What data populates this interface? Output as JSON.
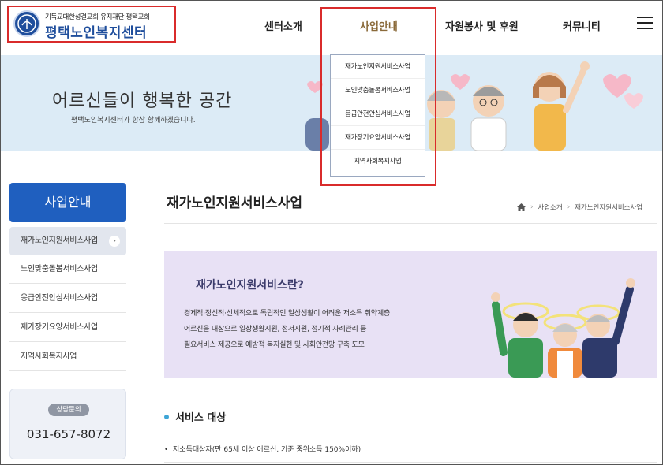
{
  "header": {
    "org_line": "기독교대한성결교회 유지재단 평택교회",
    "center_name": "평택노인복지센터",
    "nav": [
      "센터소개",
      "사업안내",
      "자원봉사 및 후원",
      "커뮤니티"
    ],
    "menu_icon": "hamburger-menu-icon"
  },
  "dropdown": {
    "items": [
      "재가노인지원서비스사업",
      "노인맞춤돌봄서비스사업",
      "응급안전안심서비스사업",
      "재가장기요양서비스사업",
      "지역사회복지사업"
    ]
  },
  "banner": {
    "title": "어르신들이 행복한 공간",
    "subtitle": "평택노인복지센터가 항상 함께하겠습니다."
  },
  "sidebar": {
    "heading": "사업안내",
    "items": [
      "재가노인지원서비스사업",
      "노인맞춤돌봄서비스사업",
      "응급안전안심서비스사업",
      "재가장기요양서비스사업",
      "지역사회복지사업"
    ],
    "active_arrow": "›",
    "contact_badge": "상담문의",
    "contact_phone": "031-657-8072"
  },
  "main": {
    "title": "재가노인지원서비스사업",
    "breadcrumb": [
      "사업소개",
      "재가노인지원서비스사업"
    ],
    "home_icon": "home-icon",
    "intro_title": "재가노인지원서비스란?",
    "intro_lines": [
      "경제적·정신적·신체적으로 독립적인 일상생활이 어려운 저소득 취약계층",
      "어르신을 대상으로 일상생활지원, 정서지원, 정기적 사례관리 등",
      "필요서비스 제공으로 예방적 복지실현 및 사회안전망 구축 도모"
    ],
    "service_title": "서비스 대상",
    "service_items": [
      "저소득대상자(만 65세 이상 어르신, 기준 중위소득 150%이하)"
    ]
  },
  "colors": {
    "accent_blue": "#1f5fbf",
    "highlight_red": "#d92b2b",
    "banner_bg": "#dcebf6",
    "intro_bg": "#e8e1f5"
  }
}
